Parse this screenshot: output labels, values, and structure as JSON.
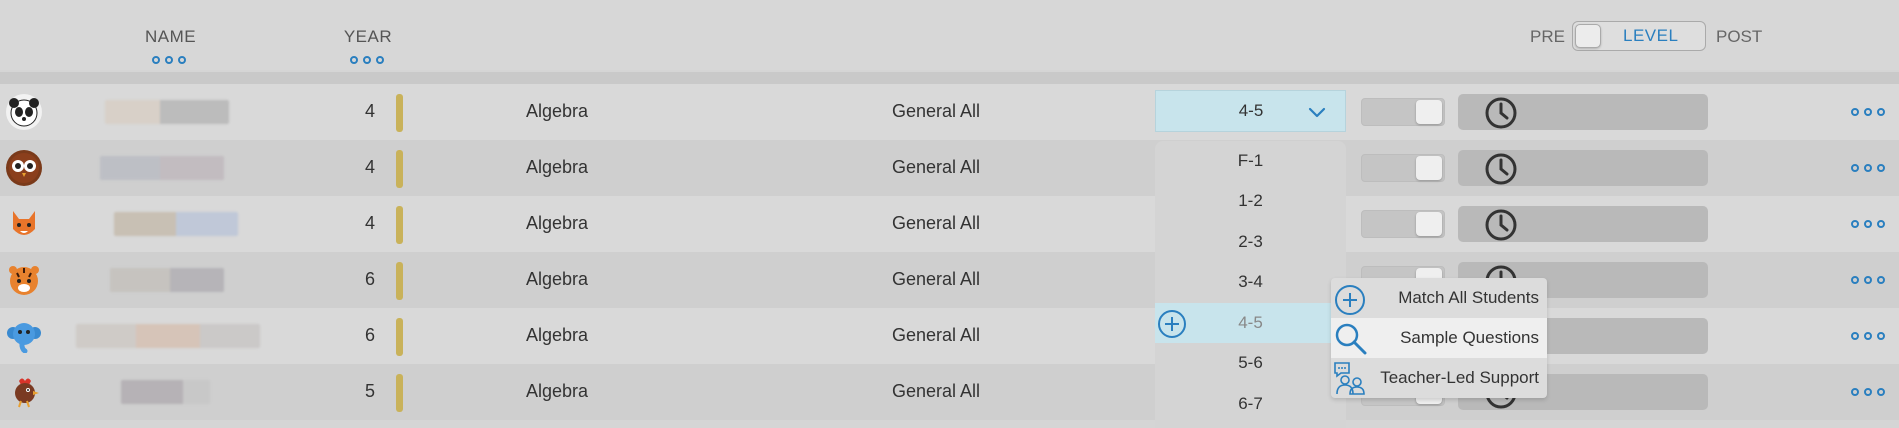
{
  "header": {
    "name_label": "NAME",
    "year_label": "YEAR",
    "pre_label": "PRE",
    "level_label": "LEVEL",
    "post_label": "POST"
  },
  "rows": [
    {
      "avatar": "panda-avatar-icon",
      "year": "4",
      "subject": "Algebra",
      "group": "General All",
      "level": "4-5"
    },
    {
      "avatar": "owl-avatar-icon",
      "year": "4",
      "subject": "Algebra",
      "group": "General All"
    },
    {
      "avatar": "fox-avatar-icon",
      "year": "4",
      "subject": "Algebra",
      "group": "General All"
    },
    {
      "avatar": "tiger-avatar-icon",
      "year": "6",
      "subject": "Algebra",
      "group": "General All"
    },
    {
      "avatar": "elephant-avatar-icon",
      "year": "6",
      "subject": "Algebra",
      "group": "General All"
    },
    {
      "avatar": "rooster-avatar-icon",
      "year": "5",
      "subject": "Algebra",
      "group": "General All"
    }
  ],
  "level_dropdown": {
    "options": [
      "F-1",
      "1-2",
      "2-3",
      "3-4",
      "4-5",
      "5-6",
      "6-7"
    ],
    "selected": "4-5"
  },
  "context_menu": {
    "items": [
      {
        "label": "Match All Students",
        "icon": "plus-circle-icon"
      },
      {
        "label": "Sample Questions",
        "icon": "search-icon"
      },
      {
        "label": "Teacher-Led Support",
        "icon": "teacher-support-icon"
      }
    ]
  },
  "colors": {
    "accent": "#2a7fbf",
    "selected_bg": "#c8e4ec",
    "year_bar": "#c9b25a"
  }
}
